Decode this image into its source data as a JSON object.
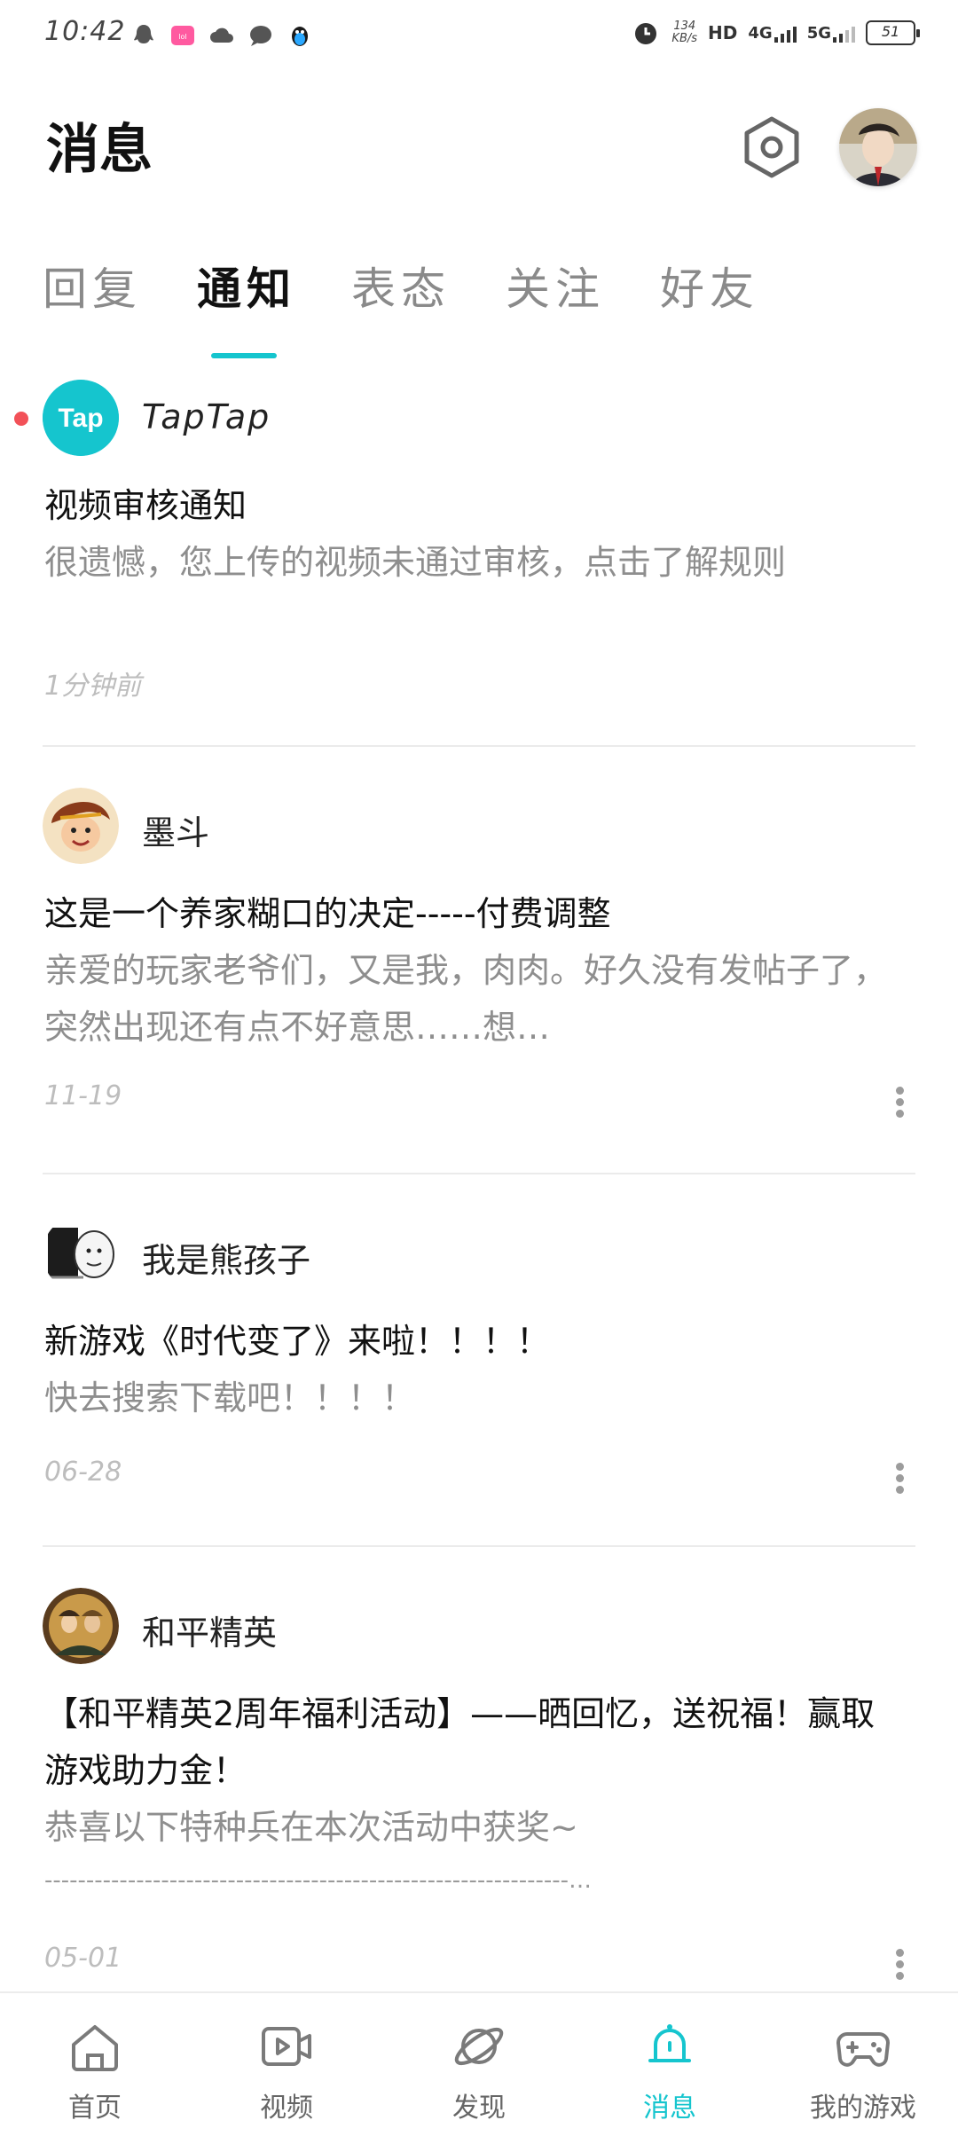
{
  "status_bar": {
    "time": "10:42",
    "net_speed_value": "134",
    "net_speed_unit": "KB/s",
    "hd": "HD",
    "net_4g": "4G",
    "net_5g": "5G",
    "battery": "51",
    "left_icons": [
      "qq-icon",
      "app-badge-icon",
      "cloud-icon",
      "chat-bubble-icon",
      "penguin-icon"
    ]
  },
  "header": {
    "title": "消息",
    "settings_icon": "gear-hexagon-icon",
    "avatar": "user-avatar"
  },
  "tabs": [
    {
      "label": "回复",
      "active": false
    },
    {
      "label": "通知",
      "active": true
    },
    {
      "label": "表态",
      "active": false
    },
    {
      "label": "关注",
      "active": false
    },
    {
      "label": "好友",
      "active": false
    }
  ],
  "messages": [
    {
      "sender": "TapTap",
      "avatar_text": "Tap",
      "unread": true,
      "title": "视频审核通知",
      "body": "很遗憾，您上传的视频未通过审核，点击了解规则",
      "time": "1分钟前"
    },
    {
      "sender": "墨斗",
      "unread": false,
      "title": "这是一个养家糊口的决定-----付费调整",
      "body": "亲爱的玩家老爷们，又是我，肉肉。好久没有发帖子了，突然出现还有点不好意思……想…",
      "time": "11-19"
    },
    {
      "sender": "我是熊孩子",
      "unread": false,
      "title": "新游戏《时代变了》来啦！！！！",
      "body": "快去搜索下载吧！！！！",
      "time": "06-28"
    },
    {
      "sender": "和平精英",
      "unread": false,
      "title": "【和平精英2周年福利活动】——晒回忆，送祝福！赢取游戏助力金！",
      "body": "恭喜以下特种兵在本次活动中获奖~",
      "body2": "---------------------------------------------------------------…",
      "time": "05-01"
    }
  ],
  "bottom_nav": [
    {
      "label": "首页",
      "icon": "home-icon",
      "active": false
    },
    {
      "label": "视频",
      "icon": "video-icon",
      "active": false
    },
    {
      "label": "发现",
      "icon": "planet-icon",
      "active": false
    },
    {
      "label": "消息",
      "icon": "bell-icon",
      "active": true
    },
    {
      "label": "我的游戏",
      "icon": "gamepad-icon",
      "active": false
    }
  ],
  "colors": {
    "accent": "#15c5ce",
    "unread_dot": "#f25158",
    "title_text": "#111111",
    "secondary_text": "#8e8e8e",
    "time_text": "#bdbdbd"
  }
}
